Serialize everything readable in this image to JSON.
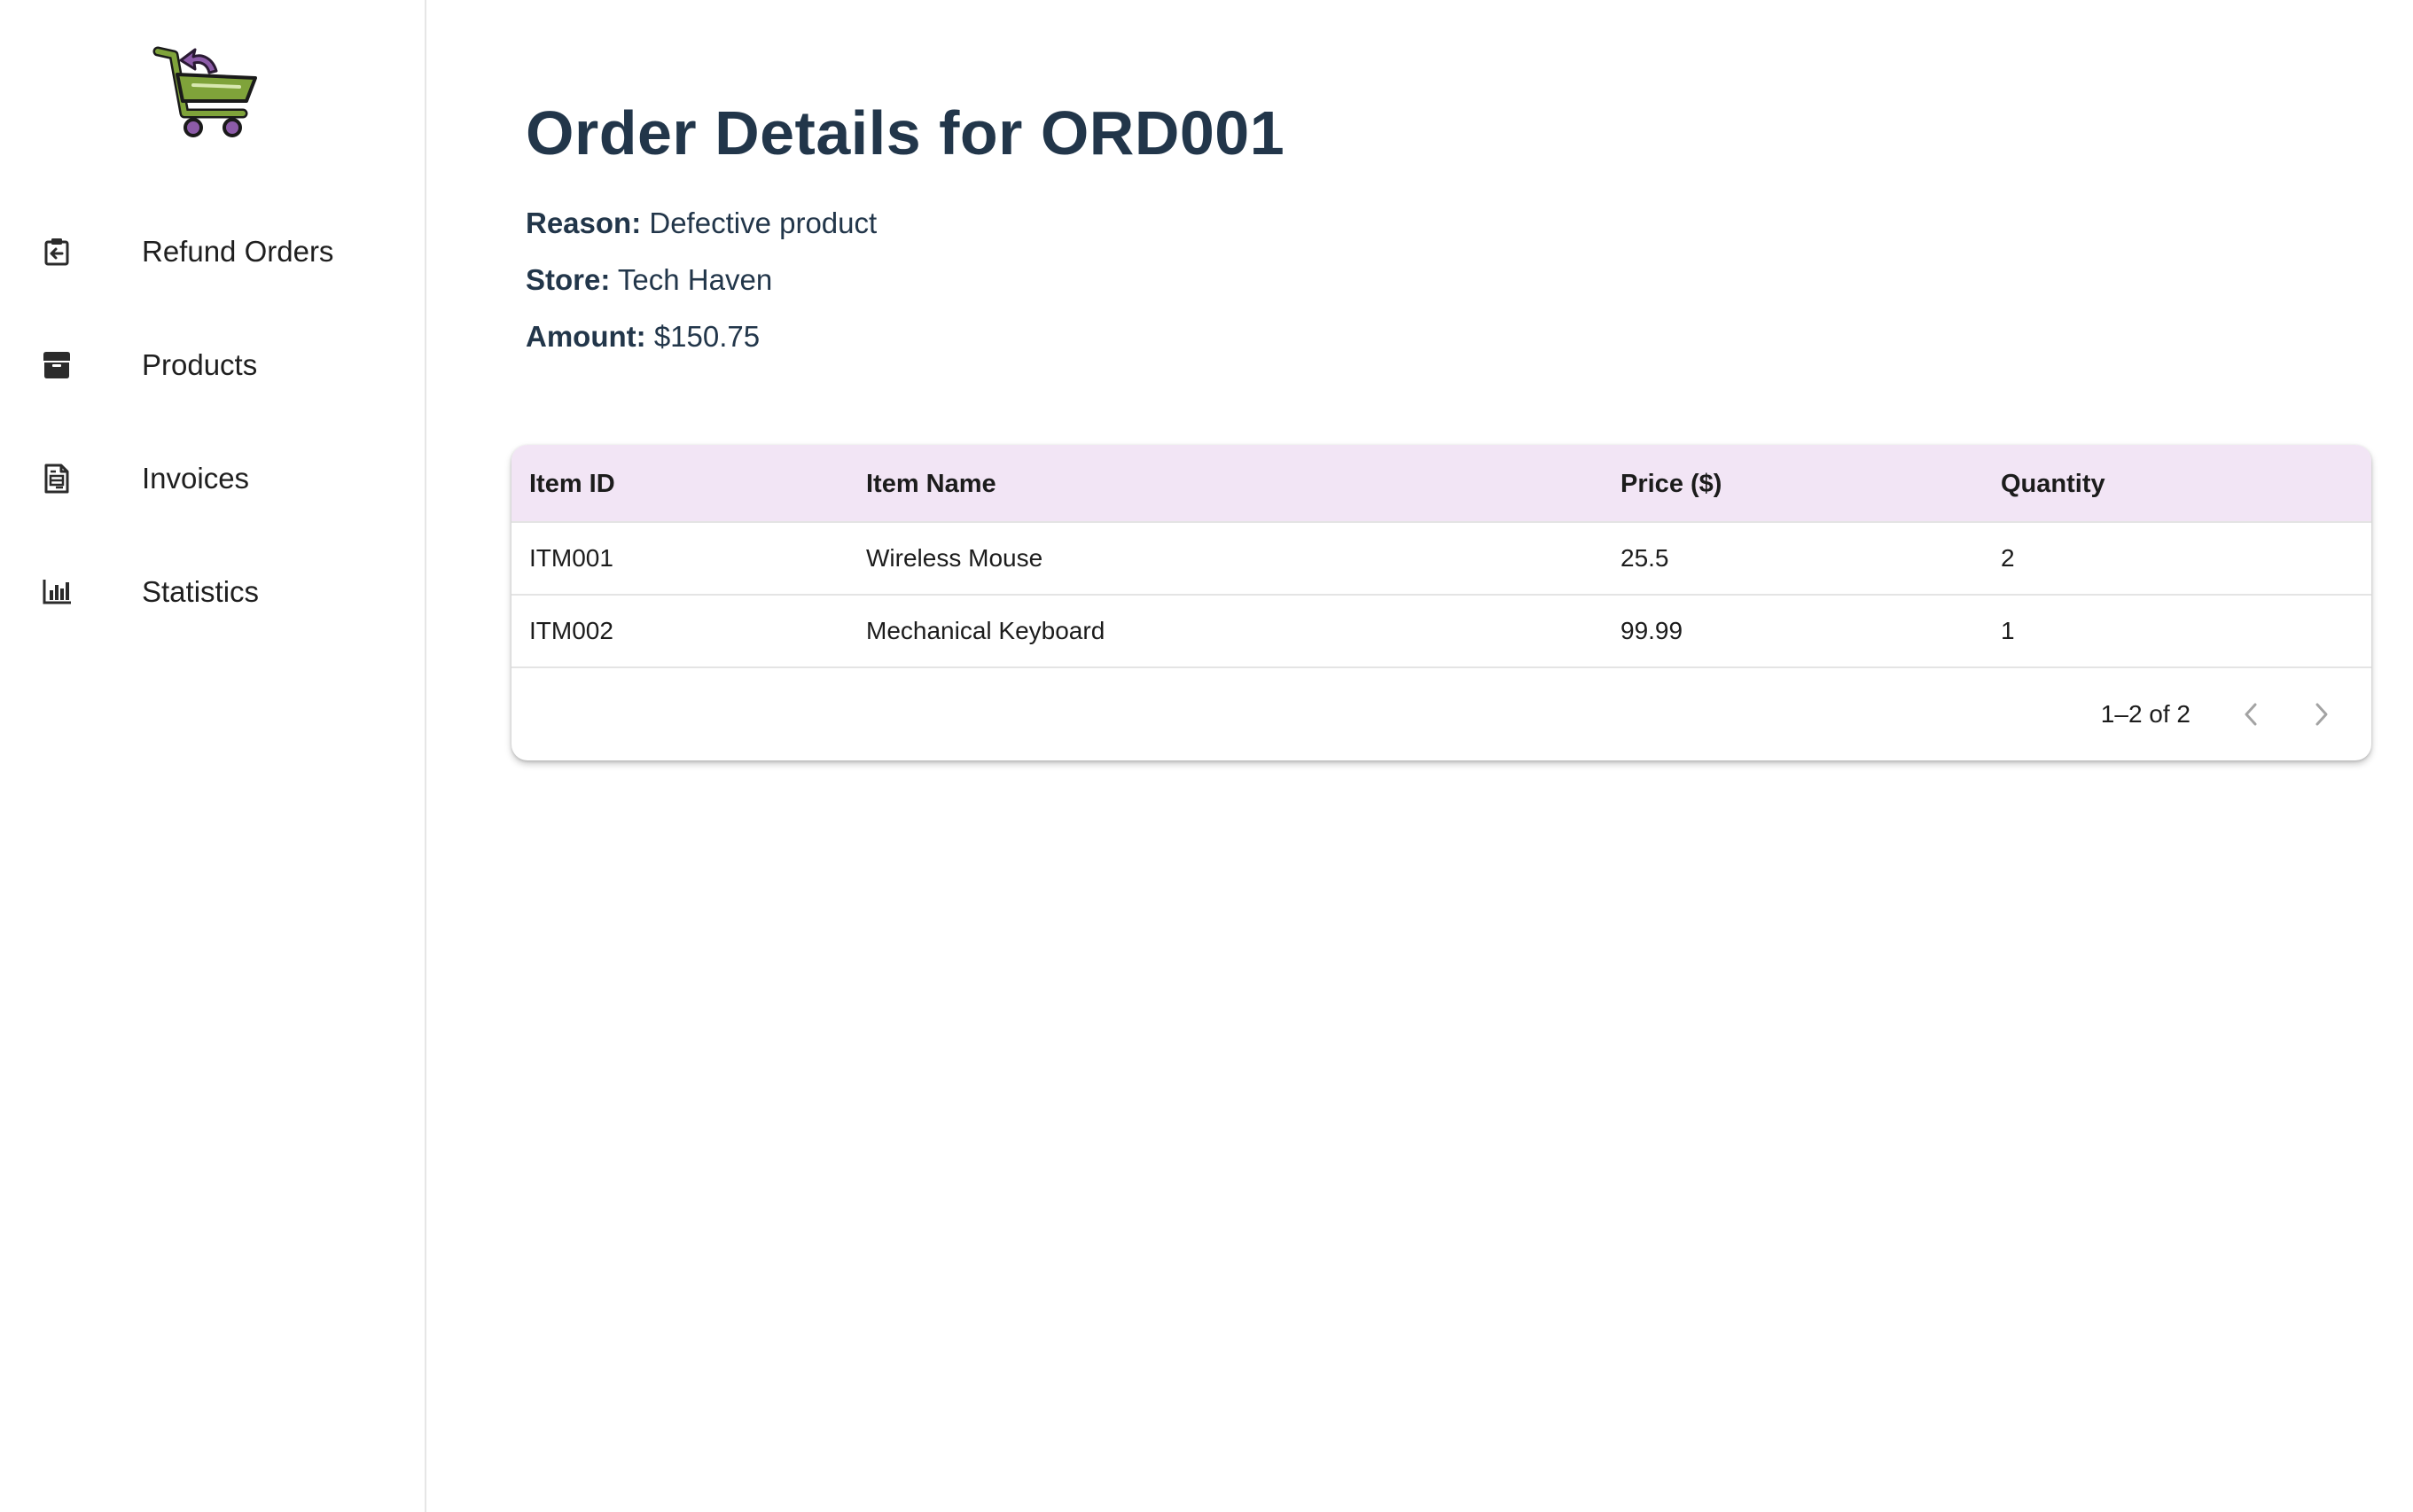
{
  "app": {
    "logo_icon": "shopping-cart-return-icon",
    "colors": {
      "title": "#22364a",
      "table_header_bg": "#f2e5f5",
      "logo_green": "#7fa33a",
      "logo_purple": "#8c5ba8"
    }
  },
  "sidebar": {
    "items": [
      {
        "label": "Refund Orders",
        "icon": "refund-clipboard-icon"
      },
      {
        "label": "Products",
        "icon": "box-icon"
      },
      {
        "label": "Invoices",
        "icon": "invoice-document-icon"
      },
      {
        "label": "Statistics",
        "icon": "bar-chart-icon"
      }
    ]
  },
  "main": {
    "title": "Order Details for ORD001",
    "details": {
      "reason_label": "Reason:",
      "reason_value": "Defective product",
      "store_label": "Store:",
      "store_value": "Tech Haven",
      "amount_label": "Amount:",
      "amount_value": "$150.75"
    },
    "table": {
      "columns": [
        "Item ID",
        "Item Name",
        "Price ($)",
        "Quantity"
      ],
      "rows": [
        [
          "ITM001",
          "Wireless Mouse",
          "25.5",
          "2"
        ],
        [
          "ITM002",
          "Mechanical Keyboard",
          "99.99",
          "1"
        ]
      ],
      "pagination": {
        "range_text": "1–2 of 2",
        "prev_icon": "chevron-left-icon",
        "next_icon": "chevron-right-icon"
      }
    }
  }
}
